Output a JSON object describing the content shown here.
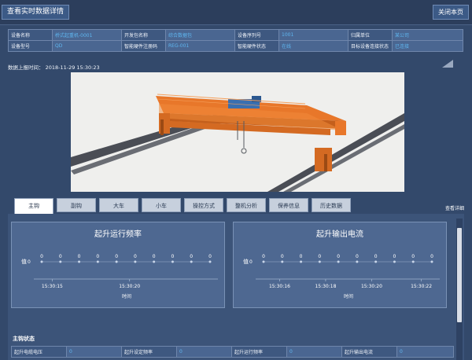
{
  "header": {
    "view_button": "查看实时数据详情",
    "close_button": "关闭本页"
  },
  "info": {
    "rows": [
      [
        {
          "label": "设备名称",
          "value": "桥式起重机-0001"
        },
        {
          "label": "开发包名称",
          "value": "综合数据包"
        },
        {
          "label": "设备序列号",
          "value": "1001"
        },
        {
          "label": "归属单位",
          "value": "某公司"
        }
      ],
      [
        {
          "label": "设备型号",
          "value": "QD"
        },
        {
          "label": "智能硬件注册码",
          "value": "REG-001"
        },
        {
          "label": "智能硬件状态",
          "value": "在线"
        },
        {
          "label": "目标设备连接状态",
          "value": "已连接"
        }
      ]
    ]
  },
  "report": {
    "label": "数据上报时间：",
    "time": "2018-11-29 15:30:23"
  },
  "tabs": [
    "主钩",
    "副钩",
    "大车",
    "小车",
    "操控方式",
    "整机分析",
    "保养信息",
    "历史数据"
  ],
  "active_tab": 0,
  "view_detail": "查看详细",
  "chart_data": [
    {
      "type": "scatter",
      "title": "起升运行频率",
      "ylabel": "值",
      "xlabel": "时间",
      "x_ticks": [
        "15:30:15",
        "15:30:20"
      ],
      "series": [
        {
          "values": [
            0,
            0,
            0,
            0,
            0,
            0,
            0,
            0,
            0,
            0
          ]
        }
      ],
      "ylim": [
        0,
        0
      ],
      "y_ticks": [
        "0"
      ]
    },
    {
      "type": "scatter",
      "title": "起升输出电流",
      "ylabel": "值",
      "xlabel": "时间",
      "x_ticks": [
        "15:30:16",
        "15:30:18",
        "15:30:20",
        "15:30:22"
      ],
      "series": [
        {
          "values": [
            0,
            0,
            0,
            0,
            0,
            0,
            0,
            0,
            0,
            0
          ]
        }
      ],
      "ylim": [
        0,
        0
      ],
      "y_ticks": [
        "0"
      ]
    }
  ],
  "status": {
    "title": "主钩状态",
    "items": [
      {
        "label": "起升电缆电压",
        "value": "0"
      },
      {
        "label": "起升设定频率",
        "value": "0"
      },
      {
        "label": "起升运行频率",
        "value": "0"
      },
      {
        "label": "起升输出电流",
        "value": "0"
      }
    ]
  },
  "colors": {
    "link": "#5fb6f0",
    "crane": "#e8772a",
    "rail": "#4a4d55",
    "background": "#33496b"
  }
}
